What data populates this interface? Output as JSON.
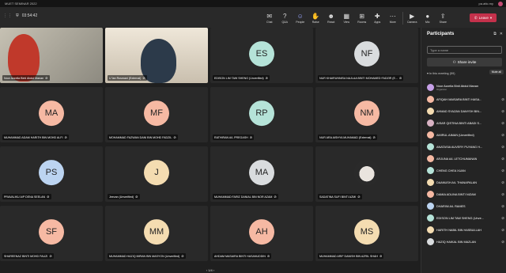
{
  "window": {
    "title": "MUET SEMINAR 2022",
    "search_hint": "pa.attc.my"
  },
  "toolbar": {
    "timer": "03:54:42",
    "items": [
      {
        "label": "Chat",
        "icon": "chat-icon"
      },
      {
        "label": "Q&A",
        "icon": "qa-icon"
      },
      {
        "label": "People",
        "icon": "people-icon",
        "badge": "59"
      },
      {
        "label": "Raise",
        "icon": "hand-icon"
      },
      {
        "label": "React",
        "icon": "react-icon"
      },
      {
        "label": "View",
        "icon": "view-icon"
      },
      {
        "label": "Rooms",
        "icon": "rooms-icon"
      },
      {
        "label": "Apps",
        "icon": "apps-icon"
      },
      {
        "label": "More",
        "icon": "more-icon"
      },
      {
        "label": "Camera",
        "icon": "camera-icon"
      },
      {
        "label": "Mic",
        "icon": "mic-icon"
      },
      {
        "label": "Share",
        "icon": "share-icon"
      }
    ],
    "leave_label": "Leave"
  },
  "grid": {
    "tiles": [
      {
        "type": "video",
        "name": "Noor Azzelia Binti Abdul Manan"
      },
      {
        "type": "video",
        "name": "U`lan Rosmani (External)"
      },
      {
        "type": "avatar",
        "initials": "ES",
        "color": "#b5e3d8",
        "name": "EDISON LIM TAW SHENG (Unverified)"
      },
      {
        "type": "avatar",
        "initials": "NF",
        "color": "#d9dcde",
        "name": "NUR KHAIRUNNISA NAJLAA BINTI MOHAMED FADZIR (E..."
      },
      {
        "type": "avatar",
        "initials": "MA",
        "color": "#f6b9a3",
        "name": "MUHAMMAD ADAM HARITH BIN MOHD ALFI"
      },
      {
        "type": "avatar",
        "initials": "MF",
        "color": "#f6b9a3",
        "name": "MOHAMMAD FAZWAN DANI BIN MOHD FADZIL"
      },
      {
        "type": "avatar",
        "initials": "RP",
        "color": "#b5e3d8",
        "name": "RATHIRAN A/L PREGASH"
      },
      {
        "type": "avatar",
        "initials": "NM",
        "color": "#f6b9a3",
        "name": "NUR ARA AISHYA MUHAMAD (External)"
      },
      {
        "type": "avatar",
        "initials": "PS",
        "color": "#bcd4f1",
        "name": "PRAVALIKU A/P DENA SEELAN"
      },
      {
        "type": "avatar",
        "initials": "J",
        "color": "#f4dcb1",
        "name": "Jeevan (Unverified)"
      },
      {
        "type": "avatar",
        "initials": "MA",
        "color": "#d9dcde",
        "name": "MUHAMMAD FARIZ DANIAL BIN NOR AZAM"
      },
      {
        "type": "photo",
        "name": "SADATINA SUFI BINTI AZMI"
      },
      {
        "type": "avatar",
        "initials": "SF",
        "color": "#f6b9a3",
        "name": "SHAREENAZ BINTI MOHD FAUZI"
      },
      {
        "type": "avatar",
        "initials": "MM",
        "color": "#f4dcb1",
        "name": "MUHAMMAD HAZIQ IMRAN BIN MASYON (Unverified)"
      },
      {
        "type": "avatar",
        "initials": "AH",
        "color": "#f6b9a3",
        "name": "AHDAM MASAIRA BINTI HASANUDDIN"
      },
      {
        "type": "avatar",
        "initials": "MS",
        "color": "#f4dcb1",
        "name": "MUHAMMAD ARIF DANISH BIN AZRIL SHAH"
      }
    ],
    "pager": "1/4"
  },
  "panel": {
    "title": "Participants",
    "search_placeholder": "Type a name",
    "share_label": "Share invite",
    "meeting_header": "In this meeting (59)",
    "mute_all": "Mute all",
    "participants": [
      {
        "name": "Noor Azzelia Binti Abdul Manan",
        "sub": "Organizer",
        "color": "#c6a0e8"
      },
      {
        "name": "AFIQAH MAISARA BINTI HASA...",
        "sub": "",
        "color": "#f6b9a3"
      },
      {
        "name": "AHMAD SYAZAN DANYSH BIN...",
        "sub": "",
        "color": "#f4dcb1"
      },
      {
        "name": "AISAR QISTINA BINTI ABADI S...",
        "sub": "",
        "color": "#d9b3c4"
      },
      {
        "name": "AMIRUL AIMAN (Unverified)",
        "sub": "",
        "color": "#f6b9a3"
      },
      {
        "name": "ANATASIA AUVERY PUYANG H...",
        "sub": "",
        "color": "#b5e3d8"
      },
      {
        "name": "ARJUNA A/L LETCHUMANAN",
        "sub": "",
        "color": "#f6b9a3"
      },
      {
        "name": "CHENG CHEA XUAN",
        "sub": "",
        "color": "#b5e3d8"
      },
      {
        "name": "DAANUSH A/L THANAPALAN",
        "sub": "",
        "color": "#f4dcb1"
      },
      {
        "name": "DAMIA ADLINA BINTI NIZAM",
        "sub": "",
        "color": "#f6b9a3"
      },
      {
        "name": "DHARINI A/L RAMES",
        "sub": "",
        "color": "#bcd4f1"
      },
      {
        "name": "EDISON LIM TAW SHENG (Unve...",
        "sub": "",
        "color": "#b5e3d8"
      },
      {
        "name": "HARITH NABIL BIN HASBULLAH",
        "sub": "",
        "color": "#f4dcb1"
      },
      {
        "name": "HAZIQ HAIKAL BIN MAZLAN",
        "sub": "",
        "color": "#d9dcde"
      }
    ]
  }
}
